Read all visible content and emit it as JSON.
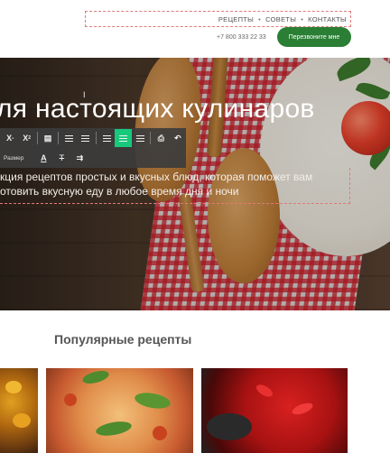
{
  "header": {
    "nav": [
      "РЕЦЕПТЫ",
      "СОВЕТЫ",
      "КОНТАКТЫ"
    ],
    "nav_separator": "•",
    "phone": "+7 800 333 22 33",
    "cta_label": "Перезвоните мне"
  },
  "hero": {
    "title": "ля настоящих кулинаров",
    "subtitle_line1": "кция рецептов простых и вкусных блюд, которая поможет вам",
    "subtitle_line2": "отовить вкусную еду в любое время дня и ночи"
  },
  "editor_toolbar": {
    "row1": [
      {
        "name": "subscript-icon",
        "glyph": "X₂"
      },
      {
        "name": "superscript-icon",
        "glyph": "X²"
      },
      {
        "name": "paste-text-icon",
        "glyph": "▤"
      },
      {
        "name": "ordered-list-icon",
        "glyph": "≔"
      },
      {
        "name": "unordered-list-icon",
        "glyph": "☰"
      },
      {
        "name": "align-left-icon",
        "glyph": "≡"
      },
      {
        "name": "align-center-icon",
        "glyph": "≡",
        "active": true
      },
      {
        "name": "align-right-icon",
        "glyph": "≡"
      },
      {
        "name": "print-icon",
        "glyph": "⎙"
      },
      {
        "name": "undo-icon",
        "glyph": "↶"
      }
    ],
    "size_label": "Размер",
    "row2": [
      {
        "name": "font-color-icon",
        "glyph": "A"
      },
      {
        "name": "strikethrough-icon",
        "glyph": "ꝶ"
      },
      {
        "name": "remove-format-icon",
        "glyph": "⇉"
      }
    ],
    "active_color": "#17c97a"
  },
  "popular": {
    "title": "Популярные рецепты"
  },
  "colors": {
    "cta": "#2a7f34",
    "guide_dashed": "#e07a7a"
  }
}
